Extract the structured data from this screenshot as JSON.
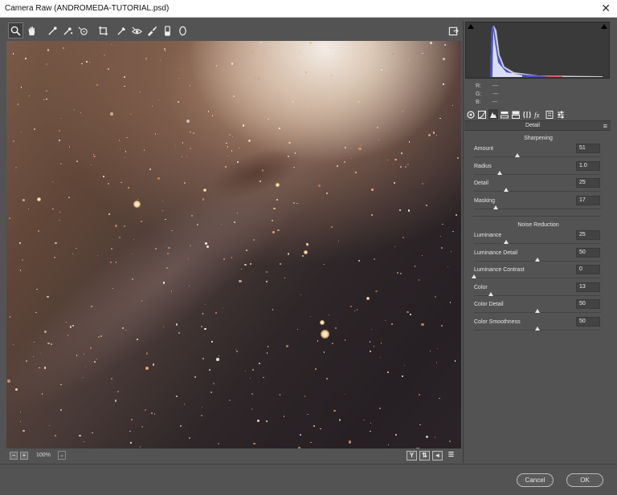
{
  "window": {
    "title": "Camera Raw (ANDROMEDA-TUTORIAL.psd)",
    "close": "✕"
  },
  "toolbar": {
    "tools": [
      {
        "name": "zoom-tool",
        "icon": "magnifier-icon"
      },
      {
        "name": "hand-tool",
        "icon": "hand-icon"
      },
      {
        "name": "white-balance-tool",
        "icon": "eyedropper-icon"
      },
      {
        "name": "color-sampler-tool",
        "icon": "color-sampler-icon"
      },
      {
        "name": "targeted-adjustment-tool",
        "icon": "targeted-adjustment-icon"
      },
      {
        "name": "crop-tool",
        "icon": "crop-icon"
      },
      {
        "name": "straighten-tool",
        "icon": "straighten-icon"
      },
      {
        "name": "red-eye-tool",
        "icon": "red-eye-icon"
      },
      {
        "name": "spot-removal-tool",
        "icon": "spot-removal-icon"
      },
      {
        "name": "adjustment-brush-tool",
        "icon": "brush-icon"
      },
      {
        "name": "graduated-filter-tool",
        "icon": "graduated-filter-icon"
      },
      {
        "name": "radial-filter-tool",
        "icon": "radial-filter-icon"
      }
    ],
    "open_preferences_icon": "export-icon"
  },
  "zoom": {
    "minus": "−",
    "plus": "+",
    "value": "100%",
    "dropdown": "⌄"
  },
  "view_buttons": {
    "y": "Y",
    "swap": "⇅",
    "copy": "◂",
    "settings": "☰"
  },
  "histogram": {
    "r_label": "R:",
    "g_label": "G:",
    "b_label": "B:",
    "r_value": "---",
    "g_value": "---",
    "b_value": "---"
  },
  "panel": {
    "title": "Detail",
    "menu_icon": "≡",
    "sharpening": {
      "heading": "Sharpening",
      "sliders": [
        {
          "label": "Amount",
          "value": "51",
          "fraction": 0.34
        },
        {
          "label": "Radius",
          "value": "1.0",
          "fraction": 0.2
        },
        {
          "label": "Detail",
          "value": "25",
          "fraction": 0.25
        },
        {
          "label": "Masking",
          "value": "17",
          "fraction": 0.17
        }
      ]
    },
    "noise_reduction": {
      "heading": "Noise Reduction",
      "sliders": [
        {
          "label": "Luminance",
          "value": "25",
          "fraction": 0.25
        },
        {
          "label": "Luminance Detail",
          "value": "50",
          "fraction": 0.5
        },
        {
          "label": "Luminance Contrast",
          "value": "0",
          "fraction": 0.0
        },
        {
          "label": "Color",
          "value": "13",
          "fraction": 0.13
        },
        {
          "label": "Color Detail",
          "value": "50",
          "fraction": 0.5
        },
        {
          "label": "Color Smoothness",
          "value": "50",
          "fraction": 0.5
        }
      ]
    }
  },
  "footer": {
    "cancel": "Cancel",
    "ok": "OK"
  },
  "colors": {
    "panel_bg": "#535353",
    "image_core": "#f4ece5",
    "star": "#ffe6c4"
  }
}
